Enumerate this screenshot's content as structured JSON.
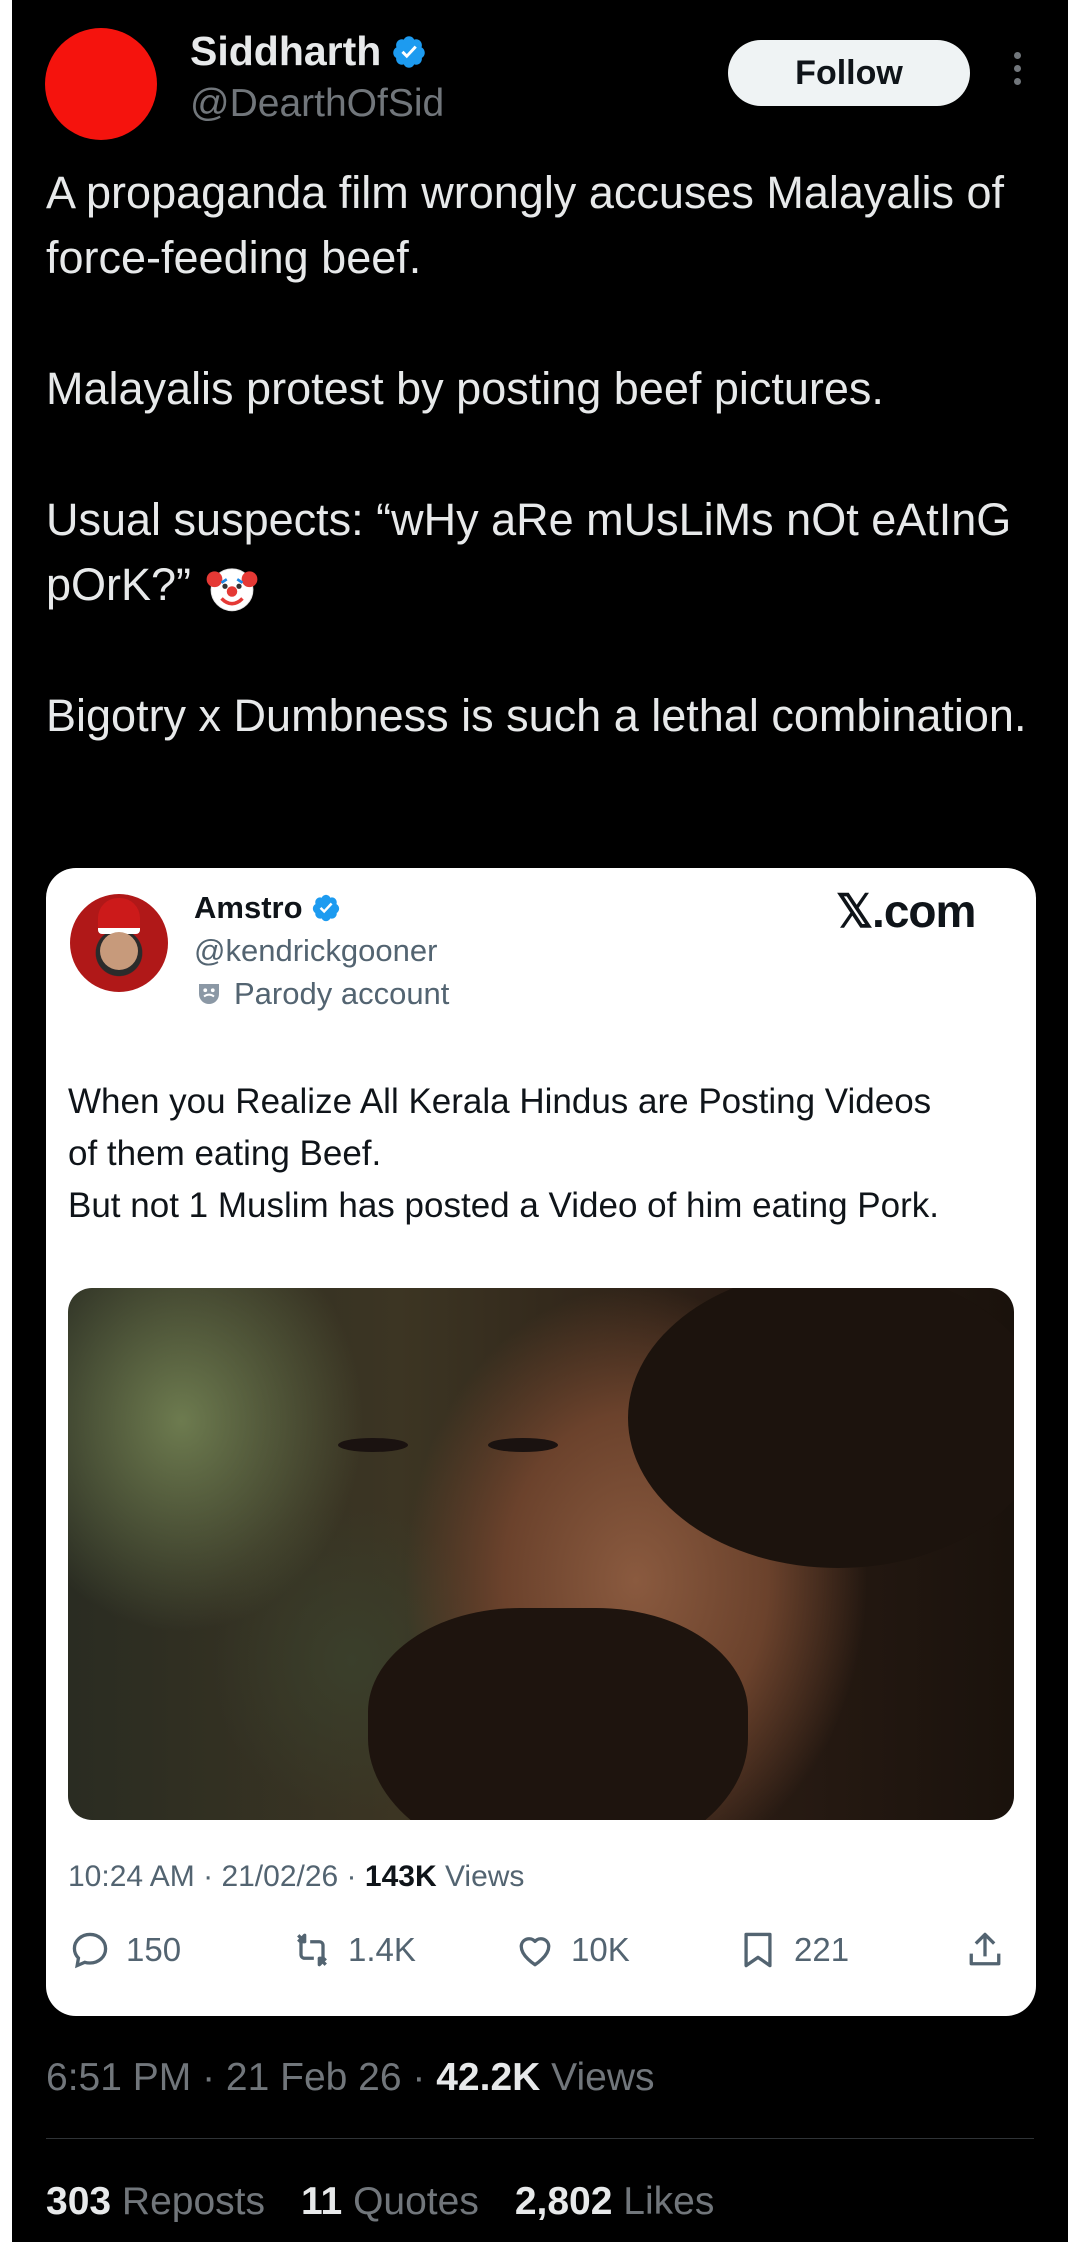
{
  "author": {
    "name": "Siddharth",
    "handle": "@DearthOfSid",
    "avatar_color": "#f5130d",
    "follow_label": "Follow"
  },
  "tweet": {
    "paragraphs": [
      "A propaganda film wrongly accuses Malayalis of force-feeding beef.",
      "Malayalis protest by posting beef pictures.",
      "Usual suspects: “wHy aRe mUsLiMs nOt eAtInG pOrK?”",
      "Bigotry x Dumbness is such a lethal combination."
    ],
    "emoji": "clown-face"
  },
  "quoted": {
    "name": "Amstro",
    "handle": "@kendrickgooner",
    "label": "Parody account",
    "site": "𝕏.com",
    "text_lines": [
      "When you Realize All Kerala Hindus are Posting Videos",
      "of them eating Beef.",
      "But not 1 Muslim has posted a Video of him eating Pork."
    ],
    "time": "10:24 AM",
    "date": "21/02/26",
    "views_count": "143K",
    "views_label": "Views",
    "replies": "150",
    "reposts": "1.4K",
    "likes": "10K",
    "bookmarks": "221"
  },
  "meta": {
    "time": "6:51 PM",
    "date": "21 Feb 26",
    "views_count": "42.2K",
    "views_label": "Views"
  },
  "stats": {
    "reposts_count": "303",
    "reposts_label": "Reposts",
    "quotes_count": "11",
    "quotes_label": "Quotes",
    "likes_count": "2,802",
    "likes_label": "Likes"
  },
  "colors": {
    "background": "#000000",
    "text": "#e7e9ea",
    "muted": "#71767b",
    "verified": "#1d9bf0"
  }
}
